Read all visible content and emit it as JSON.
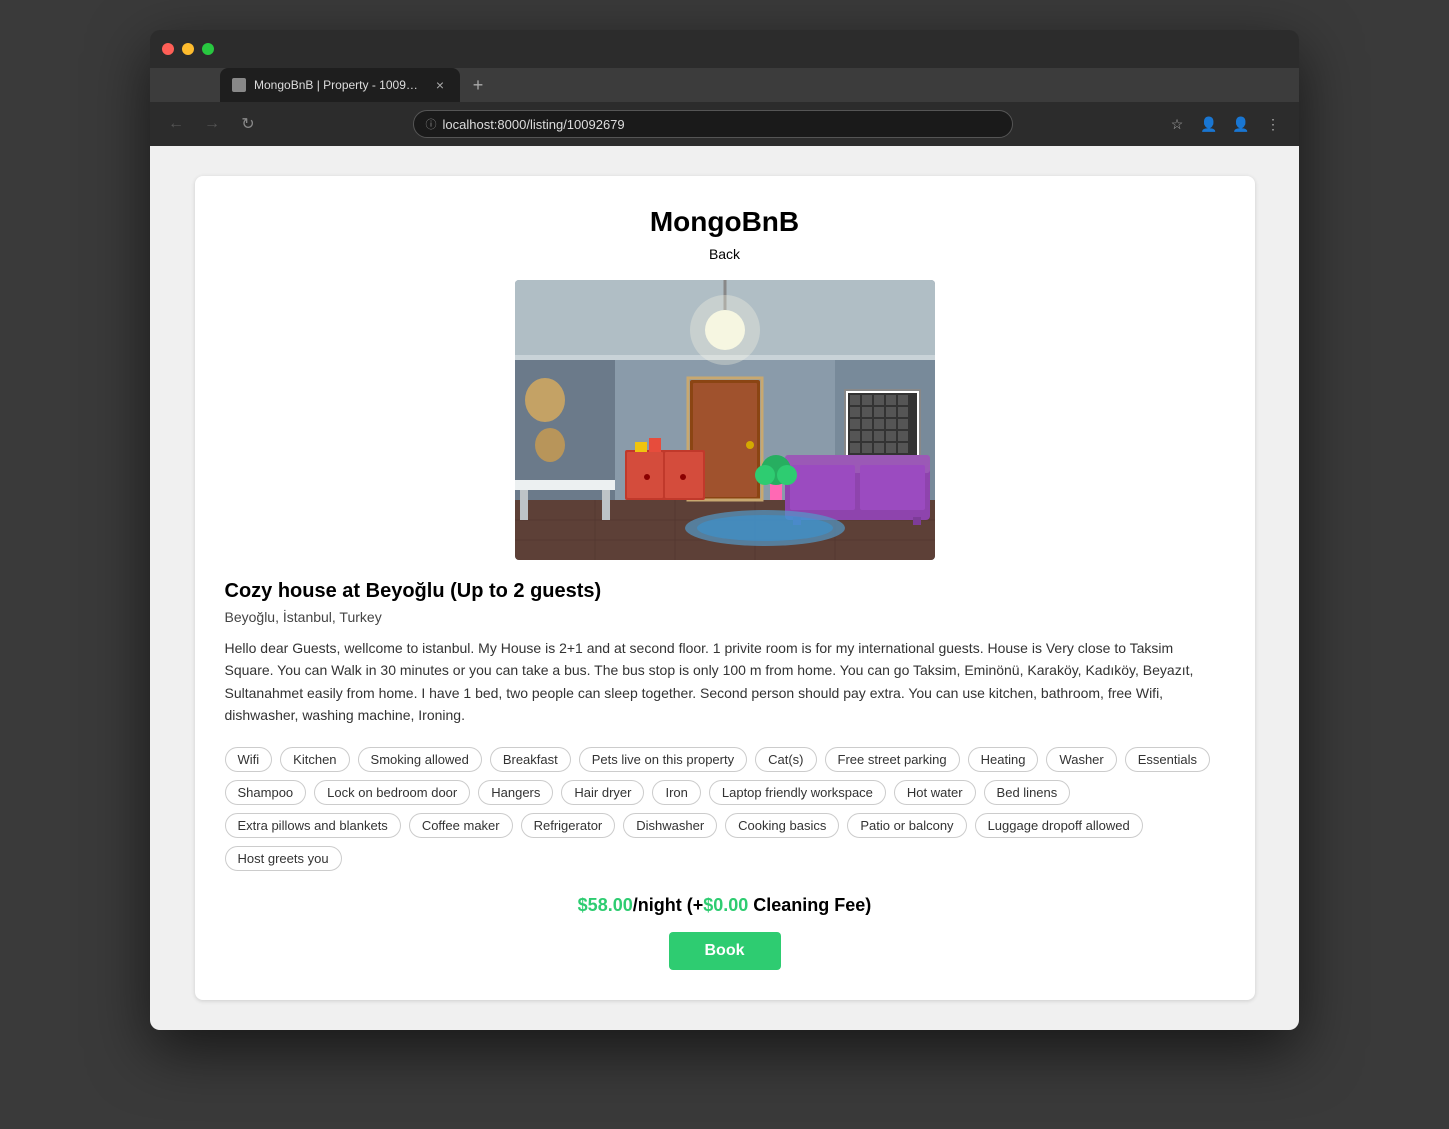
{
  "browser": {
    "tab_title": "MongoBnB | Property - 100926...",
    "url": "localhost:8000/listing/10092679",
    "nav": {
      "back": "←",
      "forward": "→",
      "reload": "↻"
    },
    "toolbar": {
      "star": "☆",
      "profile1": "👤",
      "profile2": "👤",
      "menu": "⋮",
      "new_tab": "+"
    }
  },
  "page": {
    "site_title": "MongoBnB",
    "back_link": "Back",
    "listing": {
      "title": "Cozy house at Beyoğlu (Up to 2 guests)",
      "location": "Beyoğlu, İstanbul, Turkey",
      "description": "Hello dear Guests, wellcome to istanbul. My House is 2+1 and at second floor. 1 privite room is for my international guests. House is Very close to Taksim Square. You can Walk in 30 minutes or you can take a bus. The bus stop is only 100 m from home. You can go Taksim, Eminönü, Karaköy, Kadıköy, Beyazıt, Sultanahmet easily from home. I have 1 bed, two people can sleep together. Second person should pay extra. You can use kitchen, bathroom, free Wifi, dishwasher, washing machine, Ironing.",
      "amenities": [
        "Wifi",
        "Kitchen",
        "Smoking allowed",
        "Breakfast",
        "Pets live on this property",
        "Cat(s)",
        "Free street parking",
        "Heating",
        "Washer",
        "Essentials",
        "Shampoo",
        "Lock on bedroom door",
        "Hangers",
        "Hair dryer",
        "Iron",
        "Laptop friendly workspace",
        "Hot water",
        "Bed linens",
        "Extra pillows and blankets",
        "Coffee maker",
        "Refrigerator",
        "Dishwasher",
        "Cooking basics",
        "Patio or balcony",
        "Luggage dropoff allowed",
        "Host greets you"
      ],
      "price_per_night": "$58.00",
      "cleaning_fee": "$0.00",
      "price_label": "/night (+",
      "cleaning_label": "Cleaning Fee)",
      "book_button": "Book"
    }
  }
}
